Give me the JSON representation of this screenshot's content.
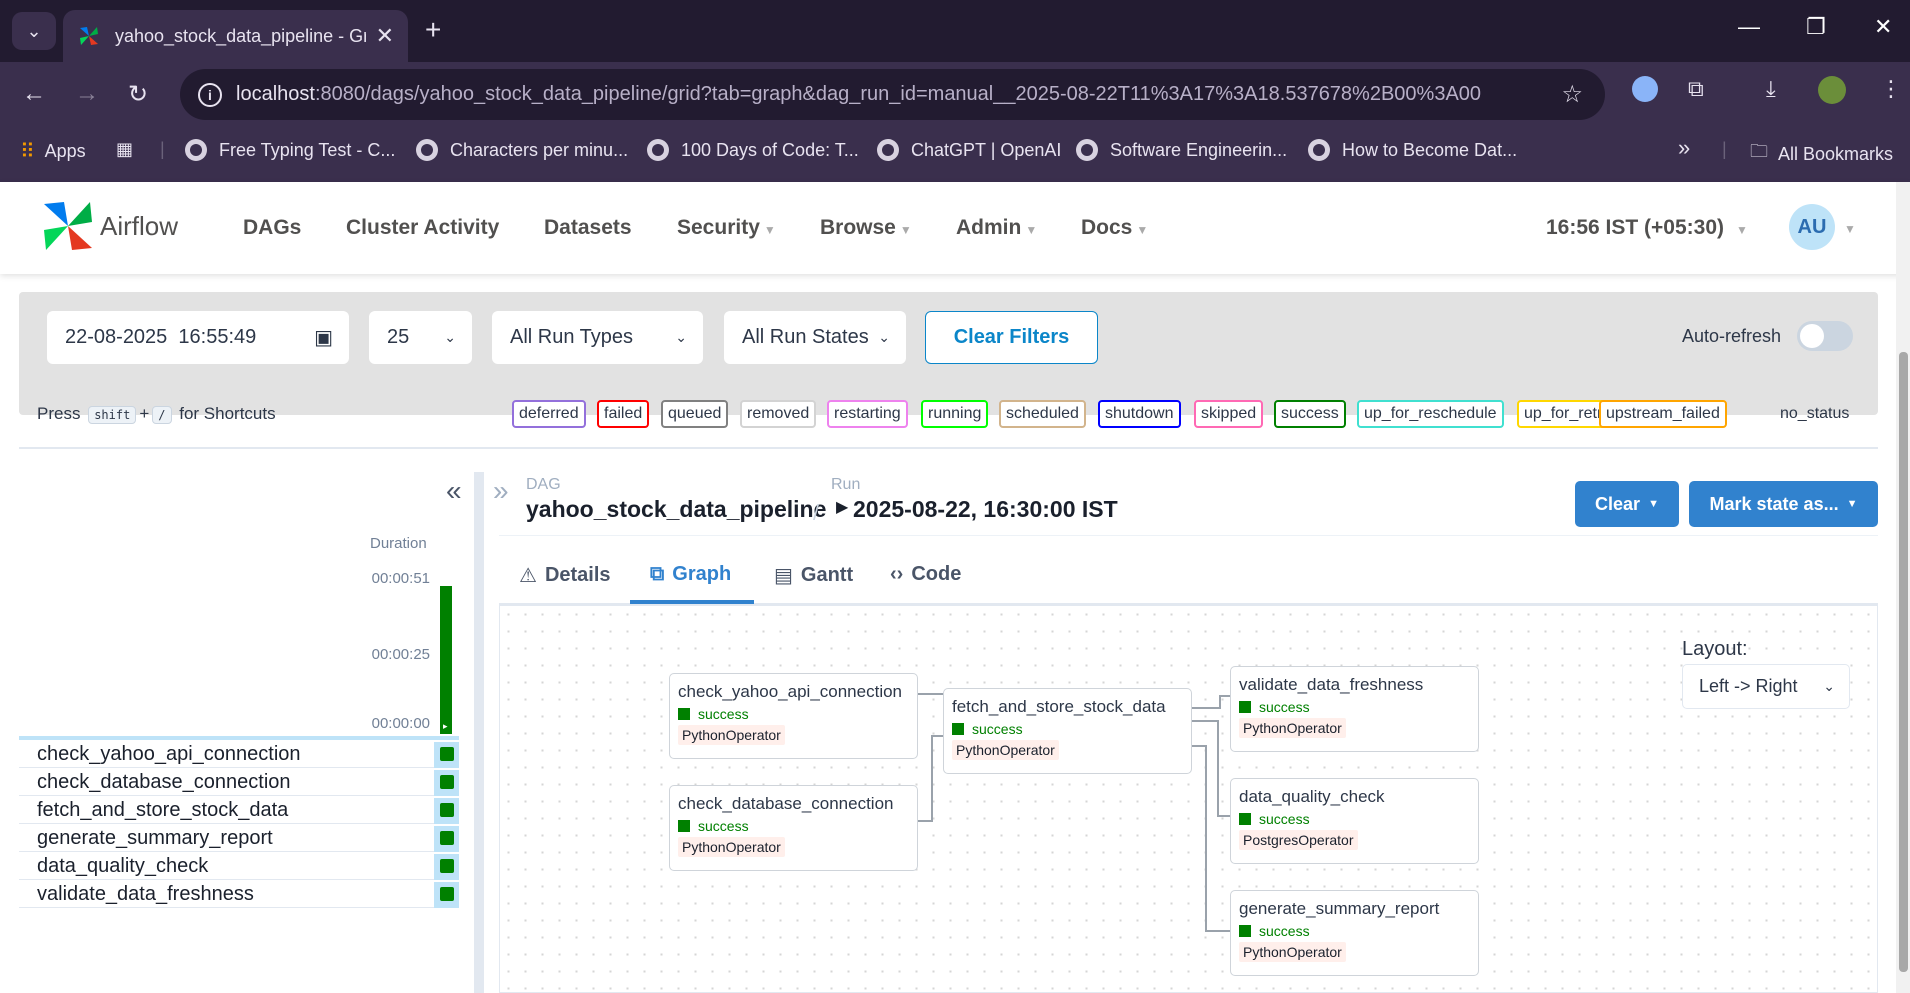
{
  "browser": {
    "tab_title": "yahoo_stock_data_pipeline - Gr",
    "url_host": "localhost",
    "url_rest": ":8080/dags/yahoo_stock_data_pipeline/grid?tab=graph&dag_run_id=manual__2025-08-22T11%3A17%3A18.537678%2B00%3A00",
    "bookmarks": [
      {
        "label": "Apps"
      },
      {
        "label": "Free Typing Test - C..."
      },
      {
        "label": "Characters per minu..."
      },
      {
        "label": "100 Days of Code: T..."
      },
      {
        "label": "ChatGPT | OpenAI"
      },
      {
        "label": "Software Engineerin..."
      },
      {
        "label": "How to Become Dat..."
      }
    ],
    "all_bookmarks": "All Bookmarks"
  },
  "navbar": {
    "brand": "Airflow",
    "items": [
      {
        "label": "DAGs"
      },
      {
        "label": "Cluster Activity"
      },
      {
        "label": "Datasets"
      },
      {
        "label": "Security"
      },
      {
        "label": "Browse"
      },
      {
        "label": "Admin"
      },
      {
        "label": "Docs"
      }
    ],
    "clock": "16:56 IST (+05:30)",
    "avatar": "AU"
  },
  "filters": {
    "datetime": "22-08-2025  16:55:49",
    "num_runs": "25",
    "run_types": "All Run Types",
    "run_states": "All Run States",
    "clear": "Clear Filters",
    "autorefresh": "Auto-refresh"
  },
  "shortcuts": {
    "press": "Press",
    "k1": "shift",
    "plus": "+",
    "k2": "/",
    "suffix": "for Shortcuts"
  },
  "legend": [
    {
      "label": "deferred",
      "color": "#9370db"
    },
    {
      "label": "failed",
      "color": "#ff0000"
    },
    {
      "label": "queued",
      "color": "#808080"
    },
    {
      "label": "removed",
      "color": "#d3d3d3"
    },
    {
      "label": "restarting",
      "color": "#ee82ee"
    },
    {
      "label": "running",
      "color": "#00ff00"
    },
    {
      "label": "scheduled",
      "color": "#d2b48c"
    },
    {
      "label": "shutdown",
      "color": "#0000ff"
    },
    {
      "label": "skipped",
      "color": "#ff69b4"
    },
    {
      "label": "success",
      "color": "#008000"
    },
    {
      "label": "up_for_reschedule",
      "color": "#40e0d0"
    },
    {
      "label": "up_for_retry",
      "color": "#ffd700"
    },
    {
      "label": "upstream_failed",
      "color": "#ffa500"
    }
  ],
  "no_status": "no_status",
  "grid": {
    "duration_label": "Duration",
    "ticks": [
      "00:00:51",
      "00:00:25",
      "00:00:00"
    ],
    "tasks": [
      "check_yahoo_api_connection",
      "check_database_connection",
      "fetch_and_store_stock_data",
      "generate_summary_report",
      "data_quality_check",
      "validate_data_freshness"
    ]
  },
  "details": {
    "dag_label": "DAG",
    "dag_id": "yahoo_stock_data_pipeline",
    "run_label": "Run",
    "run_value": "2025-08-22, 16:30:00 IST",
    "clear_btn": "Clear",
    "mark_btn": "Mark state as...",
    "tabs": [
      {
        "label": "Details"
      },
      {
        "label": "Graph"
      },
      {
        "label": "Gantt"
      },
      {
        "label": "Code"
      }
    ]
  },
  "graph": {
    "layout_label": "Layout:",
    "layout_value": "Left -> Right",
    "nodes": [
      {
        "name": "check_yahoo_api_connection",
        "state": "success",
        "operator": "PythonOperator"
      },
      {
        "name": "check_database_connection",
        "state": "success",
        "operator": "PythonOperator"
      },
      {
        "name": "fetch_and_store_stock_data",
        "state": "success",
        "operator": "PythonOperator"
      },
      {
        "name": "validate_data_freshness",
        "state": "success",
        "operator": "PythonOperator"
      },
      {
        "name": "data_quality_check",
        "state": "success",
        "operator": "PostgresOperator"
      },
      {
        "name": "generate_summary_report",
        "state": "success",
        "operator": "PythonOperator"
      }
    ]
  }
}
